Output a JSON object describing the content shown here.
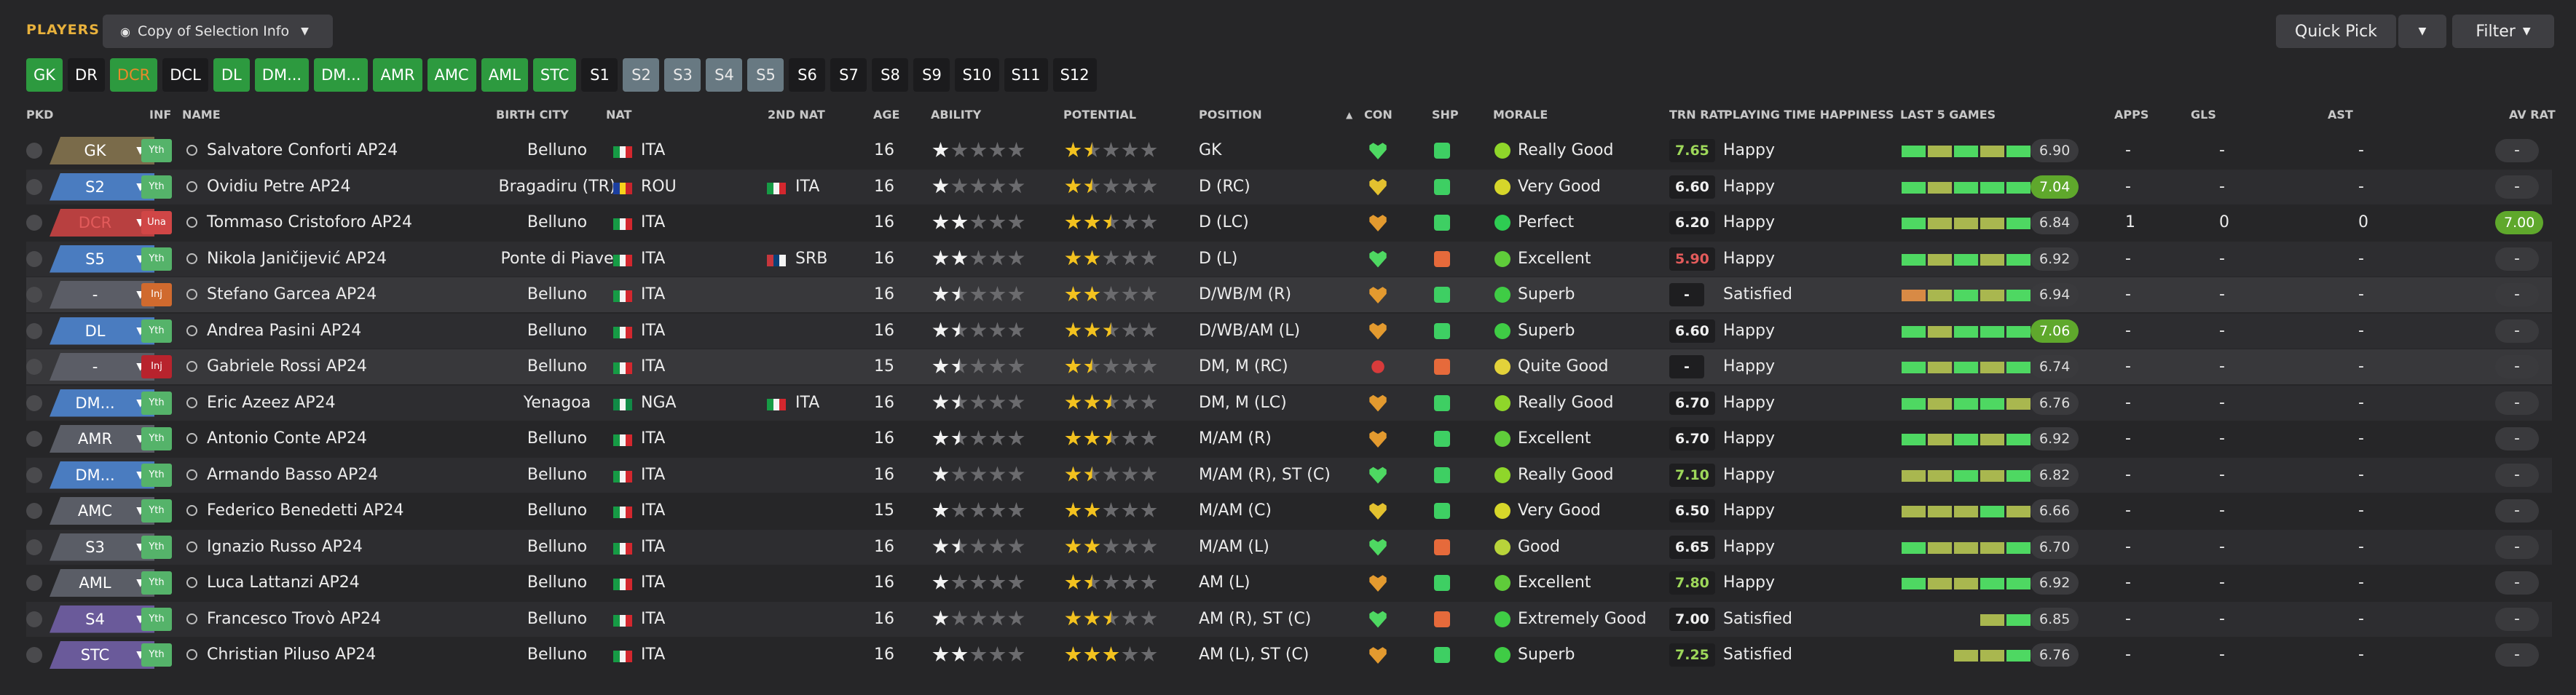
{
  "header": {
    "title": "PLAYERS",
    "view_label": "Copy of Selection Info",
    "quick_pick_label": "Quick Pick",
    "filter_label": "Filter"
  },
  "chips": [
    "GK",
    "DR",
    "DCR",
    "DCL",
    "DL",
    "DM...",
    "DM...",
    "AMR",
    "AMC",
    "AML",
    "STC",
    "S1",
    "S2",
    "S3",
    "S4",
    "S5",
    "S6",
    "S7",
    "S8",
    "S9",
    "S10",
    "S11",
    "S12"
  ],
  "columns": {
    "pkd": "PKD",
    "inf": "INF",
    "name": "NAME",
    "birth_city": "BIRTH CITY",
    "nat": "NAT",
    "nat2": "2ND NAT",
    "age": "AGE",
    "ability": "ABILITY",
    "potential": "POTENTIAL",
    "position": "POSITION",
    "con": "CON",
    "shp": "SHP",
    "morale": "MORALE",
    "trn": "TRN RAT",
    "pth": "PLAYING TIME HAPPINESS",
    "last5": "LAST 5 GAMES",
    "apps": "APPS",
    "gls": "GLS",
    "ast": "AST",
    "avrat": "AV RAT"
  },
  "colors": {
    "accent": "#e8b13c",
    "chip_green": "#2d9a3f",
    "chip_gray": "#687982",
    "rating_green": "#5fa82c",
    "perf_green": "#4ed862",
    "perf_yellowgreen": "#a9b74f",
    "perf_orange": "#d88a45"
  },
  "rows": [
    {
      "pkd": "GK",
      "inf": "Yth",
      "name": "Salvatore Conforti AP24",
      "birth_city": "Belluno",
      "nat": "ITA",
      "nat2": "",
      "age": "16",
      "ability": 1,
      "potential": 1.5,
      "position": "GK",
      "con": "green-heart-icon",
      "shp": "thumbs-up-icon",
      "morale": "Really Good",
      "morale_color": "#8fd62a",
      "trn": "7.65",
      "trn_color": "#9ed85a",
      "pth": "Happy",
      "last5": [
        "g",
        "y",
        "g",
        "y",
        "g"
      ],
      "rating": "6.90",
      "rating_green": false,
      "apps": "-",
      "gls": "-",
      "ast": "-",
      "avrat": "-"
    },
    {
      "pkd": "S2",
      "inf": "Yth",
      "name": "Ovidiu Petre AP24",
      "birth_city": "Bragadiru (TR)",
      "nat": "ROU",
      "nat2": "ITA",
      "age": "16",
      "ability": 1,
      "potential": 1.5,
      "position": "D (RC)",
      "con": "yellow-heart-icon",
      "shp": "thumbs-up-icon",
      "morale": "Very Good",
      "morale_color": "#d6d62a",
      "trn": "6.60",
      "trn_color": "#f0f0f0",
      "pth": "Happy",
      "last5": [
        "g",
        "y",
        "g",
        "g",
        "g"
      ],
      "rating": "7.04",
      "rating_green": true,
      "apps": "-",
      "gls": "-",
      "ast": "-",
      "avrat": "-"
    },
    {
      "pkd": "DCR",
      "inf": "Una",
      "name": "Tommaso Cristoforo AP24",
      "birth_city": "Belluno",
      "nat": "ITA",
      "nat2": "",
      "age": "16",
      "ability": 2,
      "potential": 2.5,
      "position": "D (LC)",
      "con": "orange-heart-icon",
      "shp": "thumbs-up-icon",
      "morale": "Perfect",
      "morale_color": "#2ecc52",
      "trn": "6.20",
      "trn_color": "#f0f0f0",
      "pth": "Happy",
      "last5": [
        "g",
        "y",
        "y",
        "y",
        "g"
      ],
      "rating": "6.84",
      "rating_green": false,
      "apps": "1",
      "gls": "0",
      "ast": "0",
      "avrat": "7.00"
    },
    {
      "pkd": "S5",
      "inf": "Yth",
      "name": "Nikola Janičijević AP24",
      "birth_city": "Ponte di Piave",
      "nat": "ITA",
      "nat2": "SRB",
      "age": "16",
      "ability": 2,
      "potential": 2,
      "position": "D (L)",
      "con": "green-heart-icon",
      "shp": "thumbs-down-icon",
      "morale": "Excellent",
      "morale_color": "#5fcc3a",
      "trn": "5.90",
      "trn_color": "#e35b5b",
      "pth": "Happy",
      "last5": [
        "g",
        "y",
        "g",
        "y",
        "g"
      ],
      "rating": "6.92",
      "rating_green": false,
      "apps": "-",
      "gls": "-",
      "ast": "-",
      "avrat": "-"
    },
    {
      "pkd": "-",
      "inf": "Inj",
      "name": "Stefano Garcea AP24",
      "birth_city": "Belluno",
      "nat": "ITA",
      "nat2": "",
      "age": "16",
      "ability": 1.5,
      "potential": 2,
      "position": "D/WB/M (R)",
      "con": "orange-heart-icon",
      "shp": "thumbs-up-icon",
      "morale": "Superb",
      "morale_color": "#3fcc45",
      "trn": "-",
      "trn_color": "#f0f0f0",
      "pth": "Satisfied",
      "last5": [
        "o",
        "y",
        "g",
        "y",
        "g"
      ],
      "rating": "6.94",
      "rating_green": false,
      "apps": "-",
      "gls": "-",
      "ast": "-",
      "avrat": "-"
    },
    {
      "pkd": "DL",
      "inf": "Yth",
      "name": "Andrea Pasini AP24",
      "birth_city": "Belluno",
      "nat": "ITA",
      "nat2": "",
      "age": "16",
      "ability": 1.5,
      "potential": 2.5,
      "position": "D/WB/AM (L)",
      "con": "orange-heart-icon",
      "shp": "thumbs-up-icon",
      "morale": "Superb",
      "morale_color": "#3fcc45",
      "trn": "6.60",
      "trn_color": "#f0f0f0",
      "pth": "Happy",
      "last5": [
        "g",
        "y",
        "g",
        "g",
        "g"
      ],
      "rating": "7.06",
      "rating_green": true,
      "apps": "-",
      "gls": "-",
      "ast": "-",
      "avrat": "-"
    },
    {
      "pkd": "-",
      "inf": "Inj",
      "name": "Gabriele Rossi AP24",
      "birth_city": "Belluno",
      "nat": "ITA",
      "nat2": "",
      "age": "15",
      "ability": 1.5,
      "potential": 1.5,
      "position": "DM, M (RC)",
      "con": "red-heart-icon",
      "shp": "thumbs-down-icon",
      "morale": "Quite Good",
      "morale_color": "#e3d23a",
      "trn": "-",
      "trn_color": "#f0f0f0",
      "pth": "Happy",
      "last5": [
        "g",
        "y",
        "g",
        "y",
        "g"
      ],
      "rating": "6.74",
      "rating_green": false,
      "apps": "-",
      "gls": "-",
      "ast": "-",
      "avrat": "-"
    },
    {
      "pkd": "DM...",
      "inf": "Yth",
      "name": "Eric Azeez AP24",
      "birth_city": "Yenagoa",
      "nat": "NGA",
      "nat2": "ITA",
      "age": "16",
      "ability": 1.5,
      "potential": 2.5,
      "position": "DM, M (LC)",
      "con": "orange-heart-icon",
      "shp": "thumbs-up-icon",
      "morale": "Really Good",
      "morale_color": "#8fd62a",
      "trn": "6.70",
      "trn_color": "#f0f0f0",
      "pth": "Happy",
      "last5": [
        "g",
        "y",
        "g",
        "g",
        "y"
      ],
      "rating": "6.76",
      "rating_green": false,
      "apps": "-",
      "gls": "-",
      "ast": "-",
      "avrat": "-"
    },
    {
      "pkd": "AMR",
      "inf": "Yth",
      "name": "Antonio Conte AP24",
      "birth_city": "Belluno",
      "nat": "ITA",
      "nat2": "",
      "age": "16",
      "ability": 1.5,
      "potential": 2.5,
      "position": "M/AM (R)",
      "con": "orange-heart-icon",
      "shp": "thumbs-up-icon",
      "morale": "Excellent",
      "morale_color": "#5fcc3a",
      "trn": "6.70",
      "trn_color": "#f0f0f0",
      "pth": "Happy",
      "last5": [
        "g",
        "y",
        "g",
        "y",
        "g"
      ],
      "rating": "6.92",
      "rating_green": false,
      "apps": "-",
      "gls": "-",
      "ast": "-",
      "avrat": "-"
    },
    {
      "pkd": "DM...",
      "inf": "Yth",
      "name": "Armando Basso AP24",
      "birth_city": "Belluno",
      "nat": "ITA",
      "nat2": "",
      "age": "16",
      "ability": 1,
      "potential": 1.5,
      "position": "M/AM (R), ST (C)",
      "con": "green-heart-icon",
      "shp": "thumbs-up-icon",
      "morale": "Really Good",
      "morale_color": "#8fd62a",
      "trn": "7.10",
      "trn_color": "#9ed85a",
      "pth": "Happy",
      "last5": [
        "y",
        "y",
        "g",
        "y",
        "g"
      ],
      "rating": "6.82",
      "rating_green": false,
      "apps": "-",
      "gls": "-",
      "ast": "-",
      "avrat": "-"
    },
    {
      "pkd": "AMC",
      "inf": "Yth",
      "name": "Federico Benedetti AP24",
      "birth_city": "Belluno",
      "nat": "ITA",
      "nat2": "",
      "age": "15",
      "ability": 1,
      "potential": 2,
      "position": "M/AM (C)",
      "con": "yellow-heart-icon",
      "shp": "thumbs-up-icon",
      "morale": "Very Good",
      "morale_color": "#d6d62a",
      "trn": "6.50",
      "trn_color": "#f0f0f0",
      "pth": "Happy",
      "last5": [
        "y",
        "y",
        "y",
        "g",
        "y"
      ],
      "rating": "6.66",
      "rating_green": false,
      "apps": "-",
      "gls": "-",
      "ast": "-",
      "avrat": "-"
    },
    {
      "pkd": "S3",
      "inf": "Yth",
      "name": "Ignazio Russo AP24",
      "birth_city": "Belluno",
      "nat": "ITA",
      "nat2": "",
      "age": "16",
      "ability": 1.5,
      "potential": 2,
      "position": "M/AM (L)",
      "con": "green-heart-icon",
      "shp": "thumbs-down-icon",
      "morale": "Good",
      "morale_color": "#b8d43a",
      "trn": "6.65",
      "trn_color": "#f0f0f0",
      "pth": "Happy",
      "last5": [
        "g",
        "y",
        "y",
        "y",
        "g"
      ],
      "rating": "6.70",
      "rating_green": false,
      "apps": "-",
      "gls": "-",
      "ast": "-",
      "avrat": "-"
    },
    {
      "pkd": "AML",
      "inf": "Yth",
      "name": "Luca Lattanzi AP24",
      "birth_city": "Belluno",
      "nat": "ITA",
      "nat2": "",
      "age": "16",
      "ability": 1,
      "potential": 1.5,
      "position": "AM (L)",
      "con": "orange-heart-icon",
      "shp": "thumbs-up-icon",
      "morale": "Excellent",
      "morale_color": "#5fcc3a",
      "trn": "7.80",
      "trn_color": "#9ed85a",
      "pth": "Happy",
      "last5": [
        "g",
        "y",
        "y",
        "g",
        "g"
      ],
      "rating": "6.92",
      "rating_green": false,
      "apps": "-",
      "gls": "-",
      "ast": "-",
      "avrat": "-"
    },
    {
      "pkd": "S4",
      "inf": "Yth",
      "name": "Francesco Trovò AP24",
      "birth_city": "Belluno",
      "nat": "ITA",
      "nat2": "",
      "age": "16",
      "ability": 1,
      "potential": 2.5,
      "position": "AM (R), ST (C)",
      "con": "green-heart-icon",
      "shp": "thumbs-down-icon",
      "morale": "Extremely Good",
      "morale_color": "#3fcc45",
      "trn": "7.00",
      "trn_color": "#f0f0f0",
      "pth": "Satisfied",
      "last5": [
        "",
        "",
        "",
        "y",
        "g"
      ],
      "rating": "6.85",
      "rating_green": false,
      "apps": "-",
      "gls": "-",
      "ast": "-",
      "avrat": "-"
    },
    {
      "pkd": "STC",
      "inf": "Yth",
      "name": "Christian Piluso AP24",
      "birth_city": "Belluno",
      "nat": "ITA",
      "nat2": "",
      "age": "16",
      "ability": 2,
      "potential": 3,
      "position": "AM (L), ST (C)",
      "con": "orange-heart-icon",
      "shp": "thumbs-up-icon",
      "morale": "Superb",
      "morale_color": "#3fcc45",
      "trn": "7.25",
      "trn_color": "#9ed85a",
      "pth": "Satisfied",
      "last5": [
        "",
        "",
        "y",
        "y",
        "g"
      ],
      "rating": "6.76",
      "rating_green": false,
      "apps": "-",
      "gls": "-",
      "ast": "-",
      "avrat": "-"
    }
  ]
}
